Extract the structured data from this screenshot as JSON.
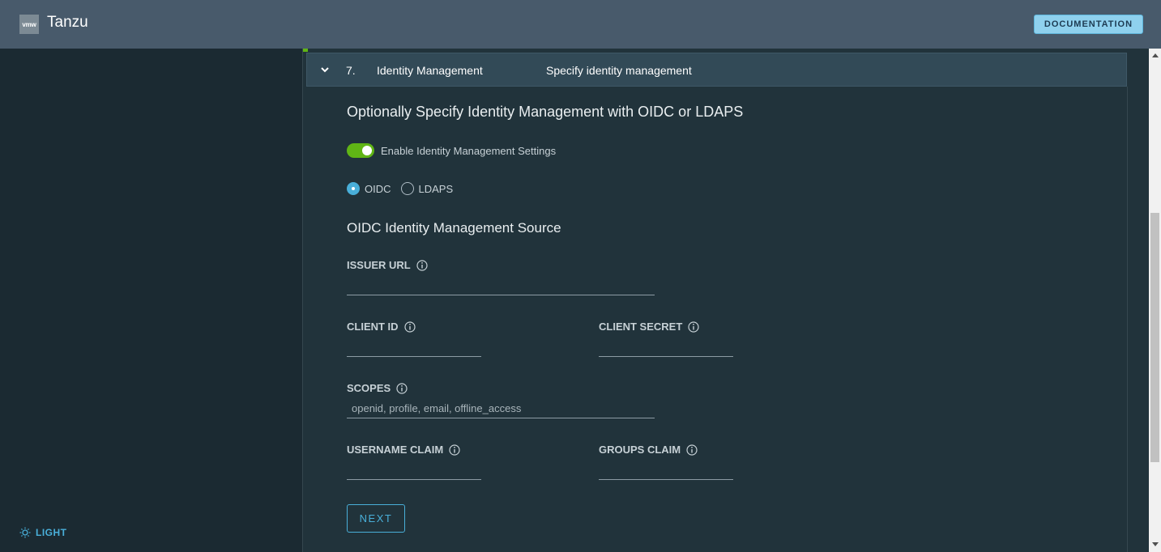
{
  "header": {
    "logo_text": "vmw",
    "app_title": "Tanzu",
    "documentation_label": "DOCUMENTATION"
  },
  "sidebar": {
    "theme_toggle_label": "LIGHT"
  },
  "step": {
    "number": "7.",
    "name": "Identity Management",
    "description": "Specify identity management"
  },
  "form": {
    "title": "Optionally Specify Identity Management with OIDC or LDAPS",
    "enable_label": "Enable Identity Management Settings",
    "enable_on": true,
    "radio_options": [
      "OIDC",
      "LDAPS"
    ],
    "selected_option": "OIDC",
    "subtitle": "OIDC Identity Management Source",
    "issuer_url": {
      "label": "ISSUER URL",
      "value": ""
    },
    "client_id": {
      "label": "CLIENT ID",
      "value": ""
    },
    "client_secret": {
      "label": "CLIENT SECRET",
      "value": ""
    },
    "scopes": {
      "label": "SCOPES",
      "placeholder": "openid, profile, email, offline_access",
      "value": ""
    },
    "username_claim": {
      "label": "USERNAME CLAIM",
      "value": ""
    },
    "groups_claim": {
      "label": "GROUPS CLAIM",
      "value": ""
    },
    "next_label": "NEXT"
  },
  "colors": {
    "header_bg": "#485a6b",
    "content_bg": "#21333b",
    "accent": "#49afd9",
    "toggle_on": "#60b515"
  }
}
